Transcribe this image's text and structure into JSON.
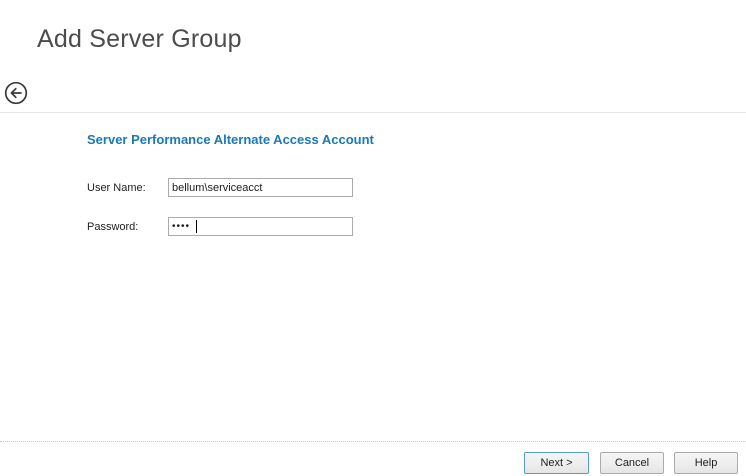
{
  "window": {
    "title": "Add Server Group"
  },
  "section": {
    "heading": "Server Performance Alternate Access Account"
  },
  "form": {
    "fields": [
      {
        "label": "User Name:",
        "value": "bellum\\serviceacct",
        "masked": false
      },
      {
        "label": "Password:",
        "value": "••••",
        "masked": true
      }
    ]
  },
  "footer": {
    "buttons": [
      {
        "label": "Next >",
        "default": true
      },
      {
        "label": "Cancel",
        "default": false
      },
      {
        "label": "Help",
        "default": false
      }
    ]
  },
  "icons": {
    "back": "back-arrow-circle-icon"
  },
  "colors": {
    "section_heading": "#1b79b7",
    "title_text": "#4c4c4c",
    "default_button_border": "#569bd5",
    "input_border": "#ababab",
    "top_divider": "#e4e8e2",
    "bottom_divider": "#cfc8b8"
  }
}
